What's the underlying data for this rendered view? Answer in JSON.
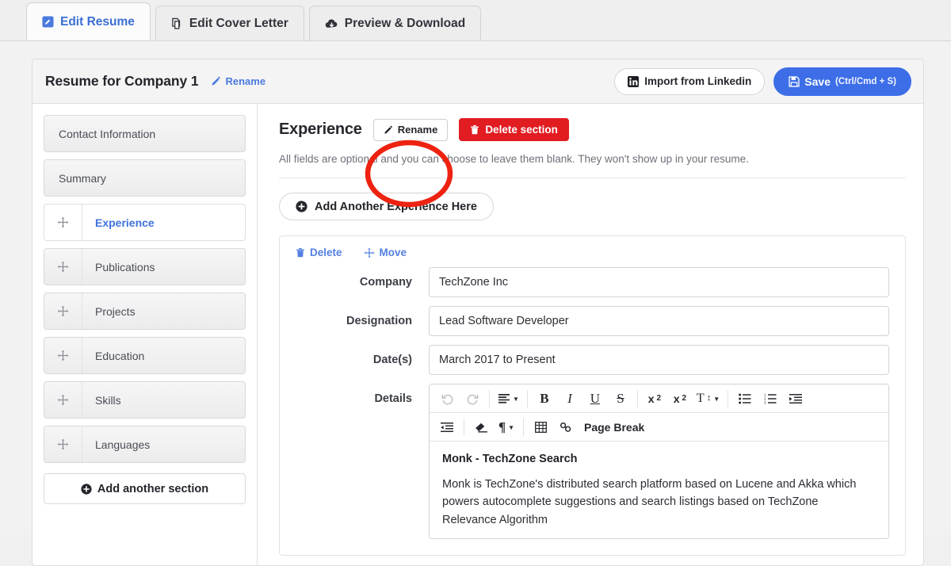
{
  "tabs": [
    {
      "id": "edit-resume",
      "label": "Edit Resume",
      "icon": "pencil-square-icon",
      "active": true
    },
    {
      "id": "edit-cover-letter",
      "label": "Edit Cover Letter",
      "icon": "copy-icon",
      "active": false
    },
    {
      "id": "preview-download",
      "label": "Preview & Download",
      "icon": "cloud-download-icon",
      "active": false
    }
  ],
  "header": {
    "title": "Resume for Company 1",
    "rename_label": "Rename",
    "import_label": "Import from Linkedin",
    "save_label": "Save",
    "save_shortcut": "(Ctrl/Cmd + S)"
  },
  "sidebar": {
    "items": [
      {
        "label": "Contact Information",
        "draggable": false,
        "active": false
      },
      {
        "label": "Summary",
        "draggable": false,
        "active": false
      },
      {
        "label": "Experience",
        "draggable": true,
        "active": true
      },
      {
        "label": "Publications",
        "draggable": true,
        "active": false
      },
      {
        "label": "Projects",
        "draggable": true,
        "active": false
      },
      {
        "label": "Education",
        "draggable": true,
        "active": false
      },
      {
        "label": "Skills",
        "draggable": true,
        "active": false
      },
      {
        "label": "Languages",
        "draggable": true,
        "active": false
      }
    ],
    "add_section_label": "Add another section"
  },
  "main": {
    "title": "Experience",
    "rename_label": "Rename",
    "delete_section_label": "Delete section",
    "helper_text": "All fields are optional and you can choose to leave them blank. They won't show up in your resume.",
    "add_entry_label": "Add Another Experience Here"
  },
  "entry": {
    "delete_label": "Delete",
    "move_label": "Move",
    "fields": [
      {
        "label": "Company",
        "value": "TechZone Inc"
      },
      {
        "label": "Designation",
        "value": "Lead Software Developer"
      },
      {
        "label": "Date(s)",
        "value": "March 2017 to Present"
      }
    ],
    "details_label": "Details",
    "toolbar": {
      "row1": [
        {
          "name": "undo-icon",
          "type": "icon",
          "disabled": true
        },
        {
          "name": "redo-icon",
          "type": "icon",
          "disabled": true
        },
        {
          "name": "align-icon",
          "type": "icon",
          "dropdown": true
        },
        {
          "name": "bold-icon",
          "type": "glyph",
          "glyph": "B"
        },
        {
          "name": "italic-icon",
          "type": "glyph",
          "glyph": "I"
        },
        {
          "name": "underline-icon",
          "type": "glyph",
          "glyph": "U"
        },
        {
          "name": "strikethrough-icon",
          "type": "glyph",
          "glyph": "S"
        },
        {
          "name": "subscript-icon",
          "type": "icon"
        },
        {
          "name": "superscript-icon",
          "type": "icon"
        },
        {
          "name": "font-size-icon",
          "type": "icon",
          "dropdown": true
        },
        {
          "name": "bullet-list-icon",
          "type": "icon"
        },
        {
          "name": "numbered-list-icon",
          "type": "icon"
        },
        {
          "name": "indent-icon",
          "type": "icon"
        }
      ],
      "row2": [
        {
          "name": "outdent-icon",
          "type": "icon"
        },
        {
          "name": "eraser-icon",
          "type": "icon"
        },
        {
          "name": "paragraph-icon",
          "type": "icon",
          "dropdown": true
        },
        {
          "name": "table-icon",
          "type": "icon"
        },
        {
          "name": "link-icon",
          "type": "icon"
        },
        {
          "name": "page-break-button",
          "type": "text",
          "label": "Page Break"
        }
      ]
    },
    "details_content": {
      "heading": "Monk - TechZone Search",
      "paragraph": "Monk is TechZone's distributed search platform based on Lucene and Akka which powers autocomplete suggestions and search listings based on TechZone Relevance Algorithm"
    }
  },
  "annotation": {
    "shape": "ellipse",
    "color": "#ee2211",
    "targets": "rename-button"
  },
  "colors": {
    "accent": "#3d6ee8",
    "danger": "#e11d22",
    "link": "#5480e2",
    "annotation": "#ee2211"
  }
}
